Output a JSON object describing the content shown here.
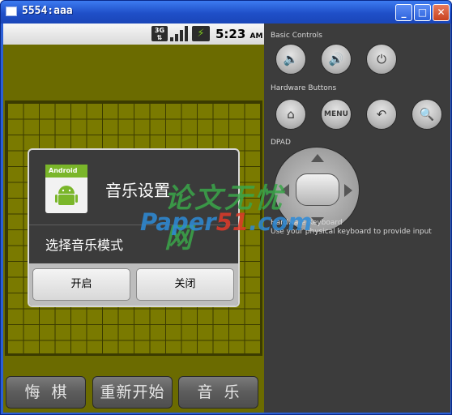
{
  "window": {
    "title": "5554:aaa"
  },
  "statusbar": {
    "network": "3G",
    "time": "5:23",
    "ampm": "AM"
  },
  "game": {
    "buttons": [
      "悔棋",
      "重新开始",
      "音乐"
    ]
  },
  "dialog": {
    "icon_label": "Android",
    "title": "音乐设置",
    "message": "选择音乐模式",
    "buttons": {
      "positive": "开启",
      "negative": "关闭"
    }
  },
  "controls": {
    "basic_label": "Basic Controls",
    "hardware_label": "Hardware Buttons",
    "menu_label": "MENU",
    "dpad_label": "DPAD",
    "keyboard_label": "Hardware Keyboard",
    "keyboard_hint": "Use your physical keyboard to provide input"
  },
  "watermark": {
    "cn": "论文无忧网",
    "en_prefix": "Paper",
    "en_num": "51",
    "en_suffix": ".com"
  },
  "icons": [
    "volume-down-icon",
    "volume-up-icon",
    "power-icon",
    "home-icon",
    "back-icon",
    "search-icon"
  ],
  "colors": {
    "board": "#7a7a00",
    "screen": "#6b6b00",
    "panel": "#3c3c3c"
  }
}
